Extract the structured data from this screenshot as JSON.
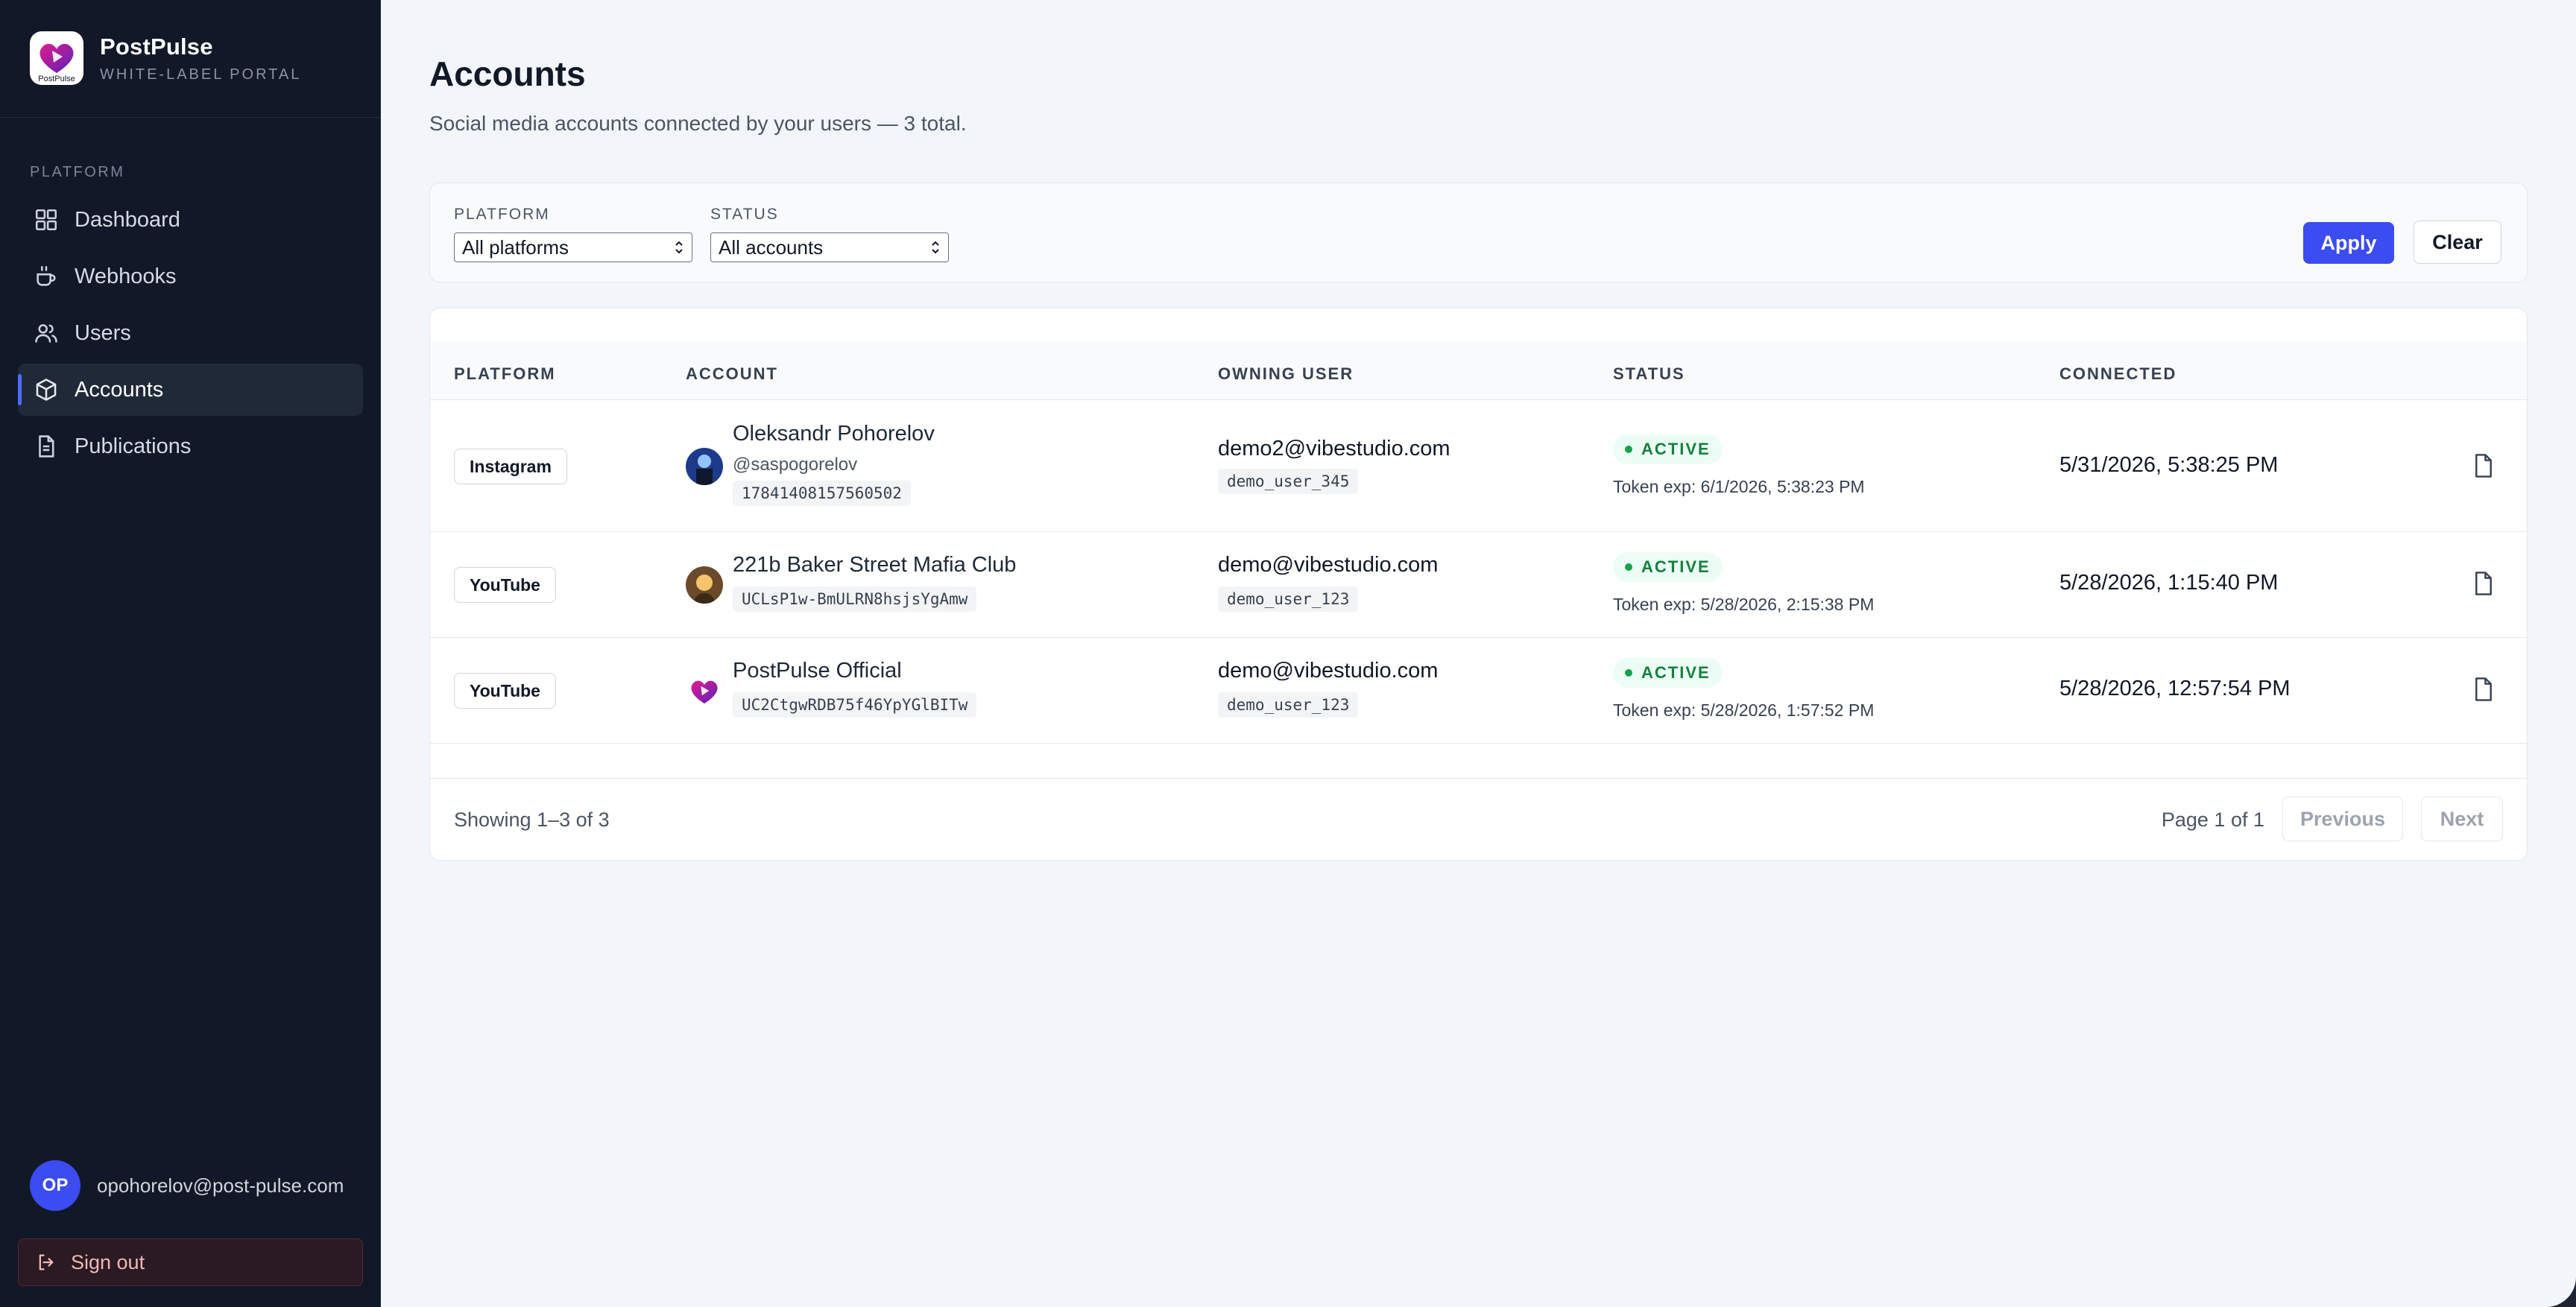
{
  "sidebar": {
    "brand_name": "PostPulse",
    "brand_sub": "WHITE-LABEL PORTAL",
    "logo_text": "PostPulse",
    "section_label": "PLATFORM",
    "items": [
      {
        "label": "Dashboard",
        "icon": "dashboard-grid-icon"
      },
      {
        "label": "Webhooks",
        "icon": "cup-icon"
      },
      {
        "label": "Users",
        "icon": "users-icon"
      },
      {
        "label": "Accounts",
        "icon": "box-icon",
        "active": true
      },
      {
        "label": "Publications",
        "icon": "document-icon"
      }
    ],
    "user_initials": "OP",
    "user_email": "opohorelov@post-pulse.com",
    "signout_label": "Sign out"
  },
  "main": {
    "title": "Accounts",
    "subtitle": "Social media accounts connected by your users — 3 total.",
    "filters": {
      "platform_label": "PLATFORM",
      "platform_value": "All platforms",
      "status_label": "STATUS",
      "status_value": "All accounts",
      "apply_label": "Apply",
      "clear_label": "Clear"
    },
    "table": {
      "headers": [
        "PLATFORM",
        "ACCOUNT",
        "OWNING USER",
        "STATUS",
        "CONNECTED"
      ],
      "rows": [
        {
          "platform": "Instagram",
          "name": "Oleksandr Pohorelov",
          "handle": "@saspogorelov",
          "account_id": "17841408157560502",
          "owner_email": "demo2@vibestudio.com",
          "owner_id": "demo_user_345",
          "status": "ACTIVE",
          "token": "Token exp: 6/1/2026, 5:38:23 PM",
          "connected": "5/31/2026, 5:38:25 PM"
        },
        {
          "platform": "YouTube",
          "name": "221b Baker Street Mafia Club",
          "account_id": "UCLsP1w-BmULRN8hsjsYgAmw",
          "owner_email": "demo@vibestudio.com",
          "owner_id": "demo_user_123",
          "status": "ACTIVE",
          "token": "Token exp: 5/28/2026, 2:15:38 PM",
          "connected": "5/28/2026, 1:15:40 PM"
        },
        {
          "platform": "YouTube",
          "name": "PostPulse Official",
          "account_id": "UC2CtgwRDB75f46YpYGlBITw",
          "owner_email": "demo@vibestudio.com",
          "owner_id": "demo_user_123",
          "status": "ACTIVE",
          "token": "Token exp: 5/28/2026, 1:57:52 PM",
          "connected": "5/28/2026, 12:57:54 PM"
        }
      ]
    },
    "footer": {
      "showing": "Showing 1–3 of 3",
      "page_info": "Page 1 of 1",
      "prev_label": "Previous",
      "next_label": "Next"
    }
  },
  "colors": {
    "sidebar_bg": "#111827",
    "accent": "#3b4cf0",
    "active_green": "#15803d",
    "main_bg": "#f2f5f9"
  }
}
